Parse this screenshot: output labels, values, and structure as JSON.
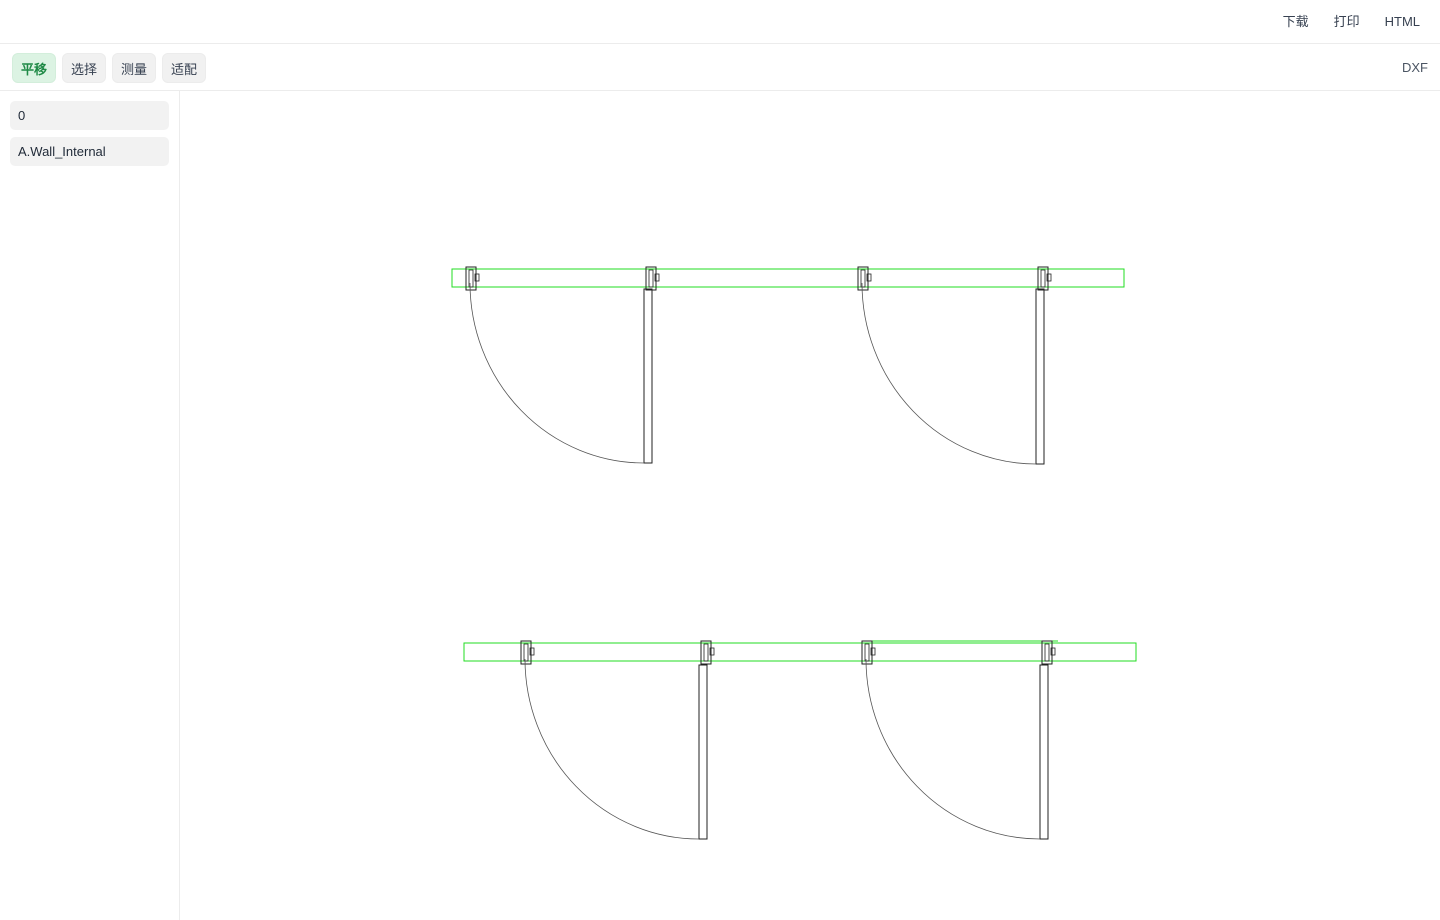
{
  "header": {
    "actions": [
      "下载",
      "打印",
      "HTML"
    ]
  },
  "toolbar": {
    "tools": [
      {
        "label": "平移",
        "active": true
      },
      {
        "label": "选择",
        "active": false
      },
      {
        "label": "测量",
        "active": false
      },
      {
        "label": "适配",
        "active": false
      }
    ],
    "format": "DXF"
  },
  "sidebar": {
    "layers": [
      {
        "name": "0"
      },
      {
        "name": "A.Wall_Internal"
      }
    ]
  },
  "drawing": {
    "colors": {
      "wall": "#22dd22",
      "door": "#222222",
      "swing_arc": "#555555",
      "background": "#ffffff"
    }
  }
}
